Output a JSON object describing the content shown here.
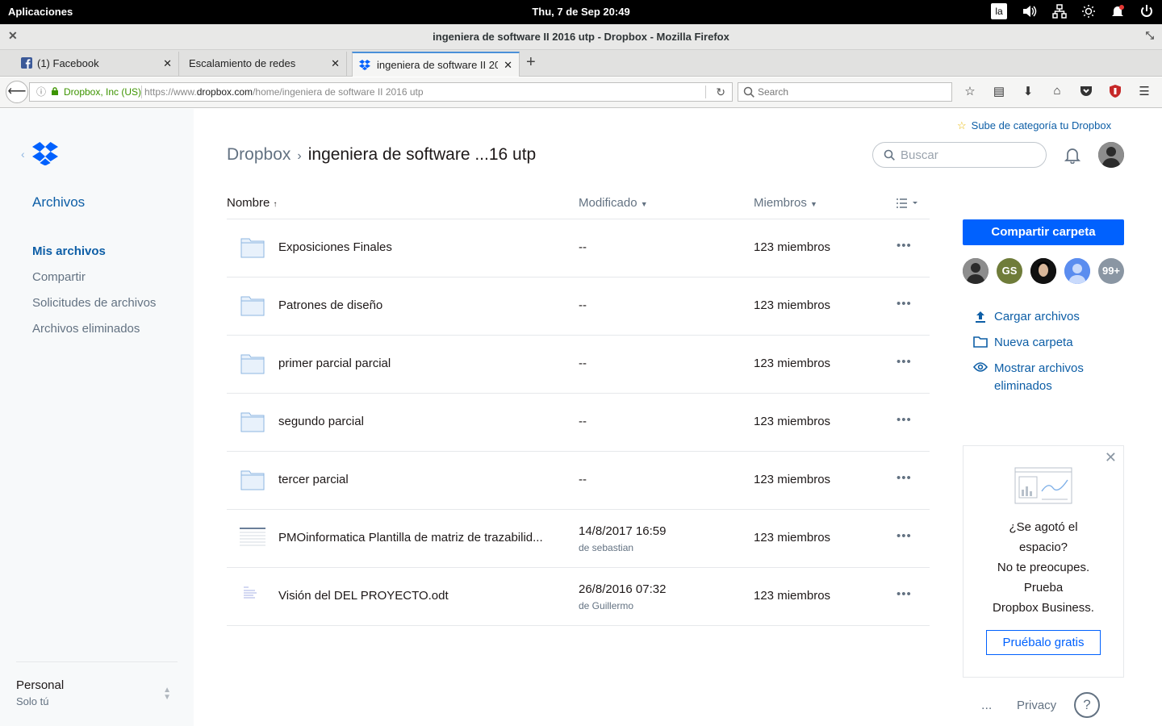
{
  "system": {
    "apps_label": "Aplicaciones",
    "clock": "Thu,  7 de Sep   20:49",
    "kbd_layout": "la"
  },
  "window": {
    "title": "ingeniera de software II 2016 utp - Dropbox - Mozilla Firefox"
  },
  "tabs": [
    {
      "label": "(1) Facebook"
    },
    {
      "label": "Escalamiento de redes"
    },
    {
      "label": "ingeniera de software II 2016 utp"
    }
  ],
  "navbar": {
    "site_identity": "Dropbox, Inc (US)",
    "url_prefix": "https://www.",
    "url_domain": "dropbox.com",
    "url_path": "/home/ingeniera de software II 2016 utp",
    "search_placeholder": "Search"
  },
  "sidebar": {
    "section_title": "Archivos",
    "items": [
      {
        "label": "Mis archivos",
        "active": true
      },
      {
        "label": "Compartir"
      },
      {
        "label": "Solicitudes de archivos"
      },
      {
        "label": "Archivos eliminados"
      }
    ],
    "account_name": "Personal",
    "account_sub": "Solo tú"
  },
  "header": {
    "upgrade_link": "Sube de categoría tu Dropbox",
    "crumb_root": "Dropbox",
    "crumb_current": "ingeniera de software ...16 utp",
    "search_placeholder": "Buscar"
  },
  "table": {
    "col_name": "Nombre",
    "col_modified": "Modificado",
    "col_members": "Miembros",
    "rows": [
      {
        "name": "Exposiciones Finales",
        "type": "folder",
        "modified": "--",
        "by": "",
        "members": "123 miembros"
      },
      {
        "name": "Patrones de diseño",
        "type": "folder",
        "modified": "--",
        "by": "",
        "members": "123 miembros"
      },
      {
        "name": "primer parcial parcial",
        "type": "folder",
        "modified": "--",
        "by": "",
        "members": "123 miembros"
      },
      {
        "name": "segundo parcial",
        "type": "folder",
        "modified": "--",
        "by": "",
        "members": "123 miembros"
      },
      {
        "name": "tercer parcial",
        "type": "folder",
        "modified": "--",
        "by": "",
        "members": "123 miembros"
      },
      {
        "name": "PMOinformatica Plantilla de matriz de trazabilid...",
        "type": "spreadsheet",
        "modified": "14/8/2017 16:59",
        "by": "de sebastian",
        "members": "123 miembros"
      },
      {
        "name": "Visión del DEL PROYECTO.odt",
        "type": "document",
        "modified": "26/8/2016 07:32",
        "by": "de Guillermo",
        "members": "123 miembros"
      }
    ]
  },
  "right_panel": {
    "share_button": "Compartir carpeta",
    "avatars": [
      {
        "kind": "photo",
        "color": "#4a4a4a"
      },
      {
        "kind": "initials",
        "text": "GS",
        "color": "#6f7c3a"
      },
      {
        "kind": "photo",
        "color": "#111111"
      },
      {
        "kind": "default",
        "color": "#5b8def"
      },
      {
        "kind": "count",
        "text": "99+",
        "color": "#8a96a3"
      }
    ],
    "actions": [
      {
        "label": "Cargar archivos",
        "icon": "upload-icon"
      },
      {
        "label": "Nueva carpeta",
        "icon": "folder-outline-icon"
      },
      {
        "label": "Mostrar archivos eliminados",
        "icon": "eye-icon"
      }
    ],
    "promo_lines": [
      "¿Se agotó el",
      "espacio?",
      "No te preocupes.",
      "Prueba",
      "Dropbox Business."
    ],
    "promo_button": "Pruébalo gratis"
  },
  "footer": {
    "more": "...",
    "privacy": "Privacy",
    "help": "?"
  },
  "colors": {
    "accent": "#0061fe",
    "link": "#0d5ea6",
    "muted": "#637282",
    "sidebar_bg": "#f7f9fa",
    "folder": "#aac8ea"
  }
}
